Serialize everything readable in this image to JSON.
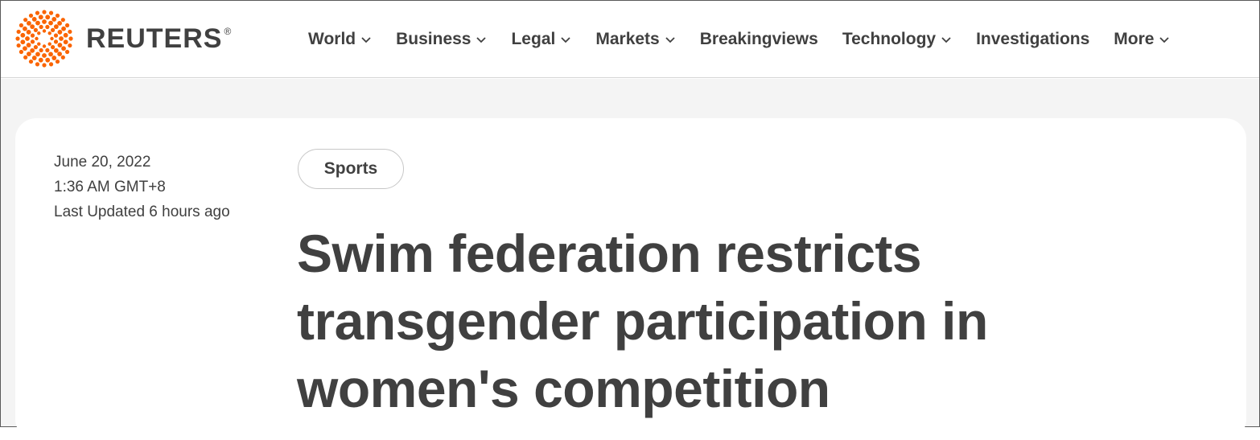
{
  "header": {
    "brand": "REUTERS",
    "registered_mark": "®",
    "brand_color": "#fa6400",
    "logo_icon": "reuters-dot-sphere-icon",
    "nav": [
      {
        "label": "World",
        "dropdown": true
      },
      {
        "label": "Business",
        "dropdown": true
      },
      {
        "label": "Legal",
        "dropdown": true
      },
      {
        "label": "Markets",
        "dropdown": true
      },
      {
        "label": "Breakingviews",
        "dropdown": false
      },
      {
        "label": "Technology",
        "dropdown": true
      },
      {
        "label": "Investigations",
        "dropdown": false
      },
      {
        "label": "More",
        "dropdown": true
      }
    ]
  },
  "article": {
    "date": "June 20, 2022",
    "time": "1:36 AM GMT+8",
    "last_updated": "Last Updated 6 hours ago",
    "section_tag": "Sports",
    "headline": "Swim federation restricts transgender participation in women's competition"
  },
  "colors": {
    "text": "#404040",
    "page_background": "#f4f4f4",
    "card_background": "#ffffff",
    "divider": "#d6d6d6"
  }
}
